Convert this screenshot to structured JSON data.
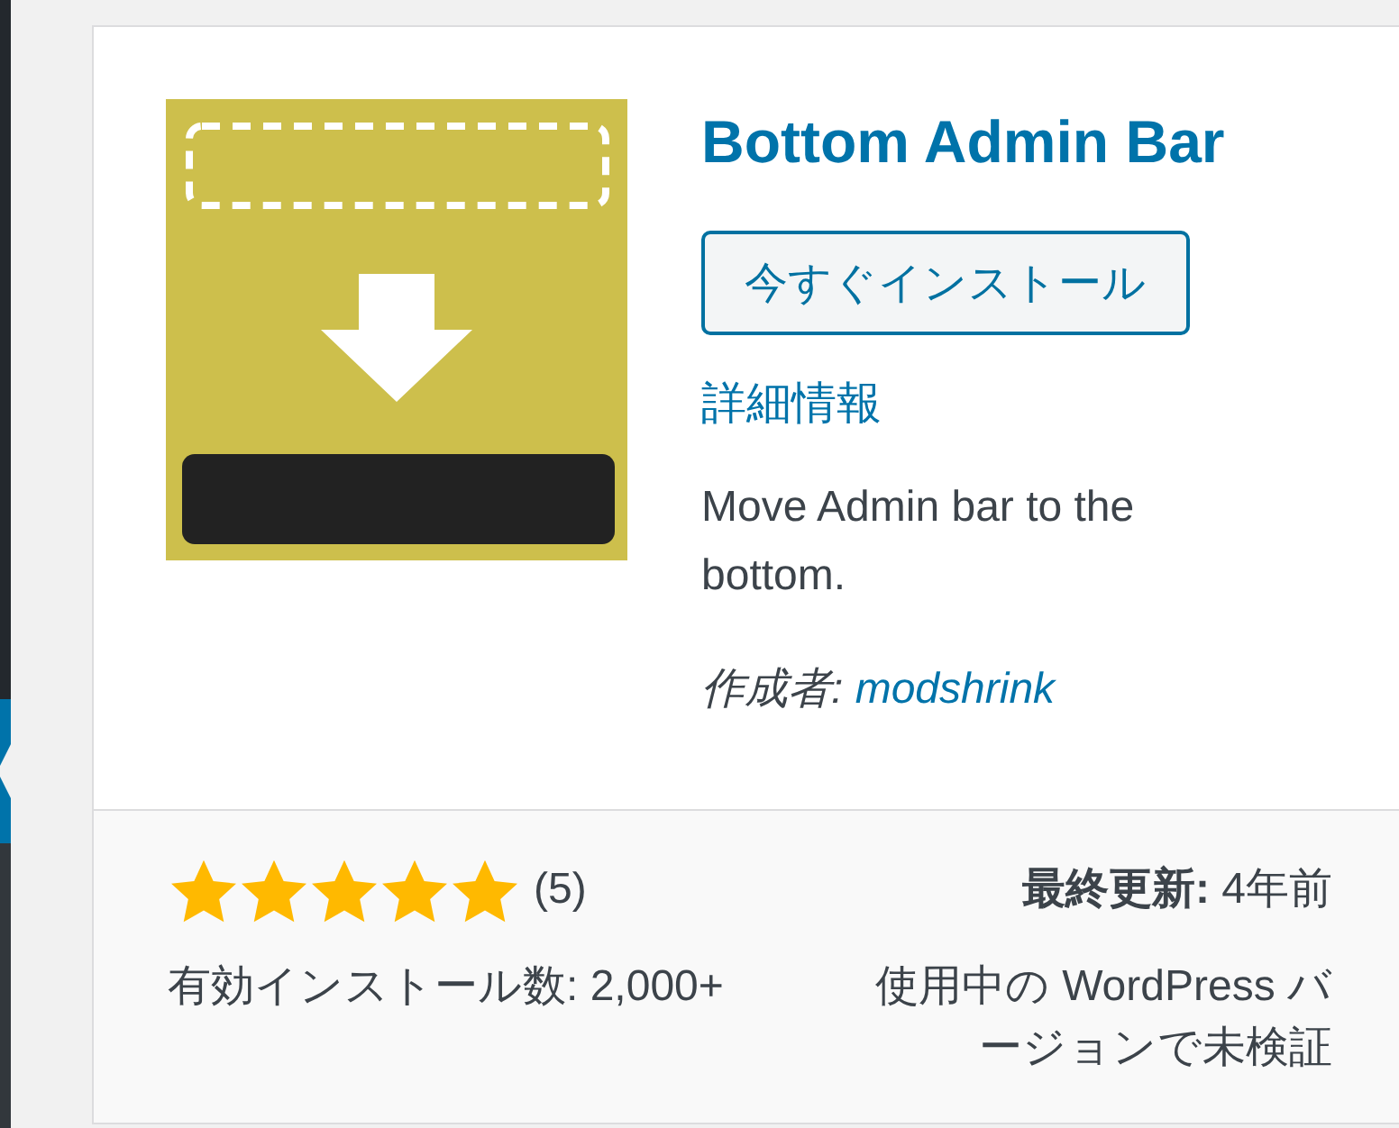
{
  "plugin_card": {
    "name": "Bottom Admin Bar",
    "install_button": "今すぐインストール",
    "details_link": "詳細情報",
    "description": "Move Admin bar to the bottom.",
    "author_label": "作成者:",
    "author": "modshrink",
    "rating": {
      "stars": 5,
      "count": "(5)"
    },
    "active_installs": "有効インストール数: 2,000+",
    "last_updated": "**最終更新:** 4年前",
    "compatibility": "使用中の WordPress バージョンで未検証"
  }
}
